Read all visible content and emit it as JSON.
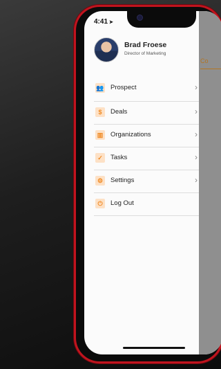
{
  "status": {
    "time": "4:41"
  },
  "profile": {
    "name": "Brad Froese",
    "role": "Director of Marketing"
  },
  "menu": [
    {
      "label": "Prospect",
      "icon": "people-icon",
      "glyph": "👥",
      "chevron": true
    },
    {
      "label": "Deals",
      "icon": "dollar-icon",
      "glyph": "$",
      "chevron": true
    },
    {
      "label": "Organizations",
      "icon": "building-icon",
      "glyph": "▥",
      "chevron": true
    },
    {
      "label": "Tasks",
      "icon": "check-icon",
      "glyph": "✓",
      "chevron": true
    },
    {
      "label": "Settings",
      "icon": "gear-icon",
      "glyph": "⚙",
      "chevron": true
    },
    {
      "label": "Log Out",
      "icon": "logout-icon",
      "glyph": "⏻",
      "chevron": false
    }
  ],
  "peek": {
    "text": "Co"
  },
  "colors": {
    "accent": "#f08a24",
    "frame": "#c0141e"
  }
}
